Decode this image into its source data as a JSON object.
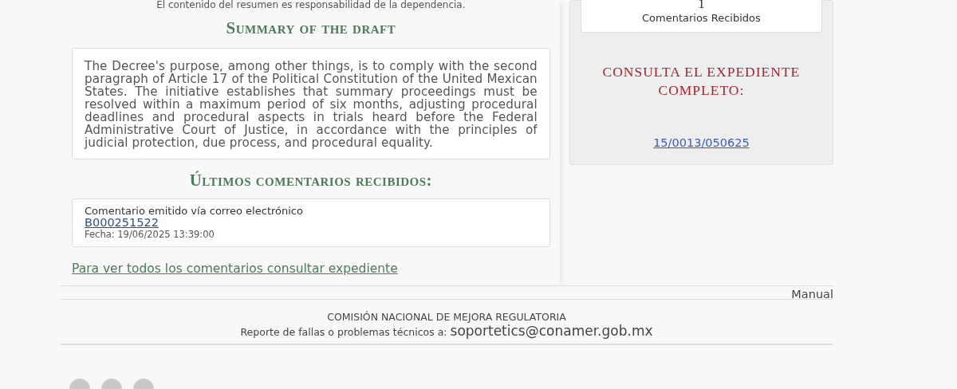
{
  "summary": {
    "note": "El contenido del resumen es responsabilidad de la dependencia.",
    "title": "Summary of the draft",
    "text": "The Decree's purpose, among other things, is to comply with the second paragraph of Article 17 of the Political Constitution of the United Mexican States. The initiative establishes that summary proceedings must be resolved within a maximum period of six months, adjusting procedural deadlines and procedural aspects in trials heard before the Federal Administrative Court of Justice, in accordance with the principles of judicial protection, due process, and procedural equality."
  },
  "comments": {
    "title": "Últimos comentarios recibidos:",
    "items": [
      {
        "source": "Comentario emitido vía correo electrónico",
        "id": "B000251522",
        "date": "Fecha: 19/06/2025 13:39:00"
      }
    ],
    "all_link": "Para ver todos los comentarios consultar expediente"
  },
  "sidebar": {
    "count": "1",
    "count_label": "Comentarios Recibidos",
    "file_title": "CONSULTA EL EXPEDIENTE COMPLETO:",
    "file_link": "15/0013/050625"
  },
  "manual_link": "Manual",
  "footer": {
    "org": "COMISIÓN NACIONAL DE MEJORA REGULATORIA",
    "report": "Reporte de fallas o problemas técnicos a:",
    "email": "soportetics@conamer.gob.mx"
  }
}
